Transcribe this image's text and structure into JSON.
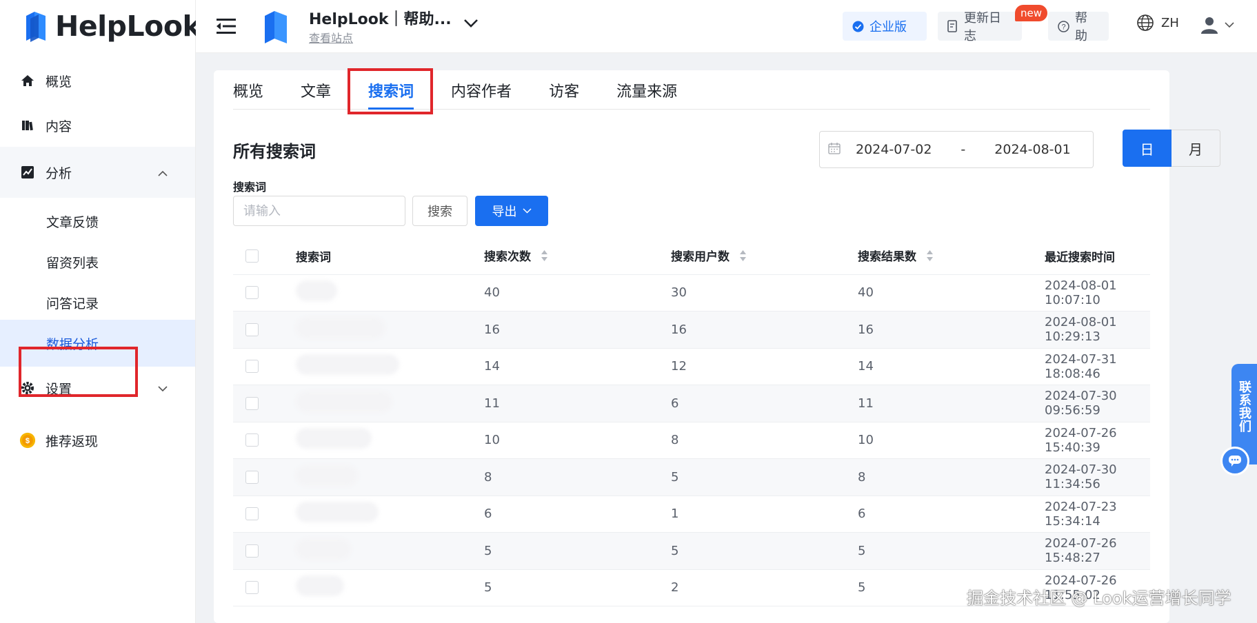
{
  "brand": {
    "name": "HelpLook"
  },
  "sidebar": {
    "items": [
      {
        "label": "概览",
        "icon": "home-icon"
      },
      {
        "label": "内容",
        "icon": "book-icon"
      },
      {
        "label": "分析",
        "icon": "chart-icon",
        "expanded": true
      },
      {
        "label": "设置",
        "icon": "gear-icon"
      },
      {
        "label": "推荐返现",
        "icon": "coin-icon"
      }
    ],
    "analysis_sub": [
      "文章反馈",
      "留资列表",
      "问答记录",
      "数据分析"
    ],
    "active_sub": "数据分析"
  },
  "header": {
    "site_title": "HelpLook｜帮助...",
    "site_sub": "查看站点",
    "enterprise": "企业版",
    "changelog": "更新日志",
    "new_badge": "new",
    "help": "帮助",
    "lang": "ZH"
  },
  "tabs": [
    "概览",
    "文章",
    "搜索词",
    "内容作者",
    "访客",
    "流量来源"
  ],
  "active_tab": "搜索词",
  "section": {
    "title": "所有搜索词",
    "date_start": "2024-07-02",
    "date_sep": "-",
    "date_end": "2024-08-01",
    "seg_day": "日",
    "seg_month": "月",
    "filter_label": "搜索词",
    "search_placeholder": "请输入",
    "search_btn": "搜索",
    "export_btn": "导出"
  },
  "table": {
    "headers": [
      "搜索词",
      "搜索次数",
      "搜索用户数",
      "搜索结果数",
      "最近搜索时间"
    ],
    "rows": [
      {
        "searches": "40",
        "users": "30",
        "results": "40",
        "time": "2024-08-01 10:07:10"
      },
      {
        "searches": "16",
        "users": "16",
        "results": "16",
        "time": "2024-08-01 10:29:13"
      },
      {
        "searches": "14",
        "users": "12",
        "results": "14",
        "time": "2024-07-31 18:08:46"
      },
      {
        "searches": "11",
        "users": "6",
        "results": "11",
        "time": "2024-07-30 09:56:59"
      },
      {
        "searches": "10",
        "users": "8",
        "results": "10",
        "time": "2024-07-26 15:40:39"
      },
      {
        "searches": "8",
        "users": "5",
        "results": "8",
        "time": "2024-07-30 11:34:56"
      },
      {
        "searches": "6",
        "users": "1",
        "results": "6",
        "time": "2024-07-23 15:34:14"
      },
      {
        "searches": "5",
        "users": "5",
        "results": "5",
        "time": "2024-07-26 15:48:27"
      },
      {
        "searches": "5",
        "users": "2",
        "results": "5",
        "time": "2024-07-26 11:55:02"
      }
    ]
  },
  "contact": {
    "label": "联系我们"
  },
  "watermark": "掘金技术社区 @ Look运营增长同学",
  "colors": {
    "accent": "#1a6ff0",
    "highlight_box": "#e0262b",
    "contact": "#3d86f2"
  }
}
